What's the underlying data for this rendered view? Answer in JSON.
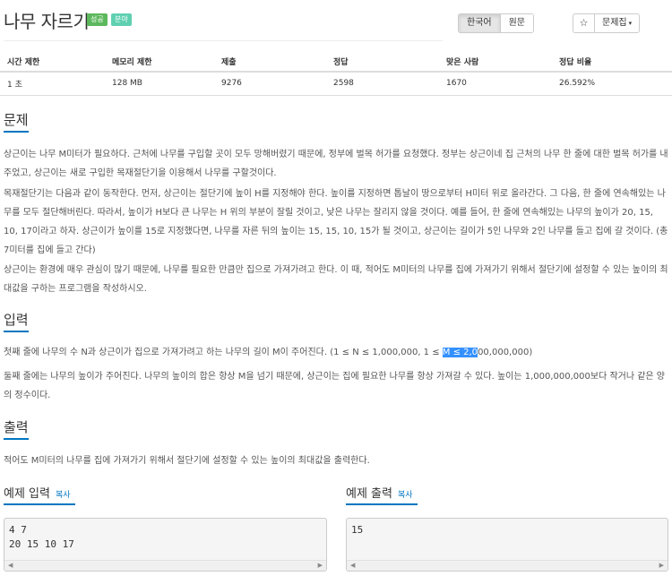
{
  "problem": {
    "title": "나무 자르기",
    "badges": [
      "성공",
      "분야"
    ]
  },
  "lang_toggle": {
    "korean": "한국어",
    "original": "원문"
  },
  "toolbar": {
    "star_icon": "☆",
    "collection_label": "문제집",
    "caret": "▾"
  },
  "stats": {
    "headers": [
      "시간 제한",
      "메모리 제한",
      "제출",
      "정답",
      "맞은 사람",
      "정답 비율"
    ],
    "values": [
      "1 초",
      "128 MB",
      "9276",
      "2598",
      "1670",
      "26.592%"
    ]
  },
  "sections": {
    "problem": {
      "title": "문제",
      "paragraphs": [
        "상근이는 나무 M미터가 필요하다. 근처에 나무를 구입할 곳이 모두 망해버렸기 때문에, 정부에 벌목 허가를 요청했다. 정부는 상근이네 집 근처의 나무 한 줄에 대한 벌목 허가를 내주었고, 상근이는 새로 구입한 목재절단기을 이용해서 나무를 구할것이다.",
        "목재절단기는 다음과 같이 동작한다. 먼저, 상근이는 절단기에 높이 H를 지정해야 한다. 높이를 지정하면 톱날이 땅으로부터 H미터 위로 올라간다. 그 다음, 한 줄에 연속해있는 나무를 모두 절단해버린다. 따라서, 높이가 H보다 큰 나무는 H 위의 부분이 잘릴 것이고, 낮은 나무는 잘리지 않을 것이다. 예를 들어, 한 줄에 연속해있는 나무의 높이가 20, 15, 10, 17이라고 하자. 상근이가 높이를 15로 지정했다면, 나무를 자른 뒤의 높이는 15, 15, 10, 15가 될 것이고, 상근이는 길이가 5인 나무와 2인 나무를 들고 집에 갈 것이다. (총 7미터를 집에 들고 간다)",
        "상근이는 환경에 매우 관심이 많기 때문에, 나무를 필요한 만큼만 집으로 가져가려고 한다. 이 때, 적어도 M미터의 나무를 집에 가져가기 위해서 절단기에 설정할 수 있는 높이의 최대값을 구하는 프로그램을 작성하시오."
      ]
    },
    "input": {
      "title": "입력",
      "line1_before": "첫째 줄에 나무의 수 N과 상근이가 집으로 가져가려고 하는 나무의 길이 M이 주어진다. (1 ≤ N ≤ 1,000,000, 1 ≤ ",
      "line1_highlight": "M ≤ 2,0",
      "line1_after": "00,000,000)",
      "line2": "둘째 줄에는 나무의 높이가 주어진다. 나무의 높이의 합은 항상 M을 넘기 때문에, 상근이는 집에 필요한 나무를 항상 가져갈 수 있다. 높이는 1,000,000,000보다 작거나 같은 양의 정수이다."
    },
    "output": {
      "title": "출력",
      "text": "적어도 M미터의 나무를 집에 가져가기 위해서 절단기에 설정할 수 있는 높이의 최대값을 출력한다."
    }
  },
  "samples": {
    "input": {
      "title": "예제 입력",
      "copy": "복사",
      "content": "4 7\n20 15 10 17"
    },
    "output": {
      "title": "예제 출력",
      "copy": "복사",
      "content": "15"
    }
  },
  "scroll": {
    "left_arrow": "◀",
    "right_arrow": "▶"
  },
  "colors": {
    "accent": "#0076c0",
    "success": "#5cb85c",
    "multi": "#5fd0b0",
    "highlight": "#3390ff"
  }
}
